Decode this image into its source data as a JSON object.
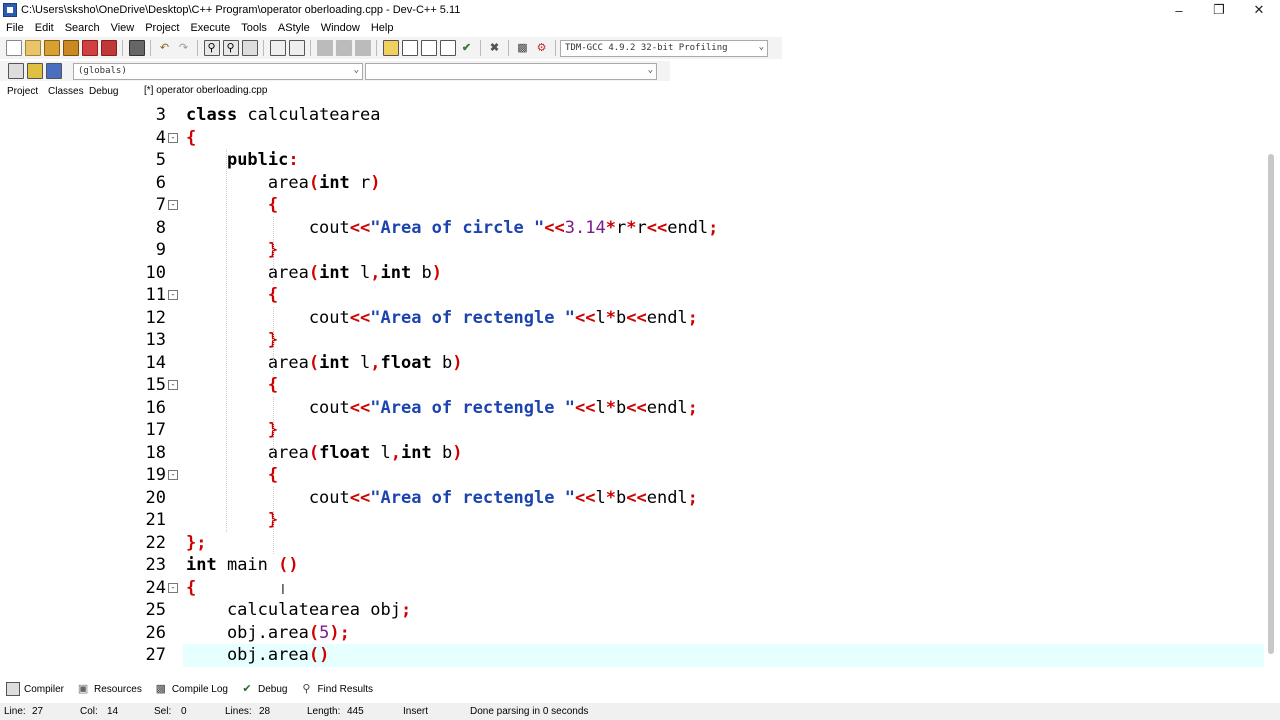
{
  "window": {
    "title": "C:\\Users\\sksho\\OneDrive\\Desktop\\C++ Program\\operator oberloading.cpp - Dev-C++ 5.11"
  },
  "menu": [
    "File",
    "Edit",
    "Search",
    "View",
    "Project",
    "Execute",
    "Tools",
    "AStyle",
    "Window",
    "Help"
  ],
  "toolbar": {
    "compiler_select": "TDM-GCC 4.9.2 32-bit Profiling",
    "scope_select": "(globals)",
    "symbol_select": ""
  },
  "left_tabs": [
    "Project",
    "Classes",
    "Debug"
  ],
  "file_tab": "[*] operator oberloading.cpp",
  "editor": {
    "lines": [
      {
        "n": "3",
        "fold": false,
        "text": "class calculatearea"
      },
      {
        "n": "4",
        "fold": true,
        "text": "{"
      },
      {
        "n": "5",
        "fold": false,
        "text": "    public:"
      },
      {
        "n": "6",
        "fold": false,
        "text": "        area(int r)"
      },
      {
        "n": "7",
        "fold": true,
        "text": "        {"
      },
      {
        "n": "8",
        "fold": false,
        "text": "            cout<<\"Area of circle \"<<3.14*r*r<<endl;"
      },
      {
        "n": "9",
        "fold": false,
        "text": "        }"
      },
      {
        "n": "10",
        "fold": false,
        "text": "        area(int l,int b)"
      },
      {
        "n": "11",
        "fold": true,
        "text": "        {"
      },
      {
        "n": "12",
        "fold": false,
        "text": "            cout<<\"Area of rectengle \"<<l*b<<endl;"
      },
      {
        "n": "13",
        "fold": false,
        "text": "        }"
      },
      {
        "n": "14",
        "fold": false,
        "text": "        area(int l,float b)"
      },
      {
        "n": "15",
        "fold": true,
        "text": "        {"
      },
      {
        "n": "16",
        "fold": false,
        "text": "            cout<<\"Area of rectengle \"<<l*b<<endl;"
      },
      {
        "n": "17",
        "fold": false,
        "text": "        }"
      },
      {
        "n": "18",
        "fold": false,
        "text": "        area(float l,int b)"
      },
      {
        "n": "19",
        "fold": true,
        "text": "        {"
      },
      {
        "n": "20",
        "fold": false,
        "text": "            cout<<\"Area of rectengle \"<<l*b<<endl;"
      },
      {
        "n": "21",
        "fold": false,
        "text": "        }"
      },
      {
        "n": "22",
        "fold": false,
        "text": "};"
      },
      {
        "n": "23",
        "fold": false,
        "text": "int main ()"
      },
      {
        "n": "24",
        "fold": true,
        "text": "{"
      },
      {
        "n": "25",
        "fold": false,
        "text": "    calculatearea obj;"
      },
      {
        "n": "26",
        "fold": false,
        "text": "    obj.area(5);"
      },
      {
        "n": "27",
        "fold": false,
        "text": "    obj.area()",
        "current": true
      }
    ]
  },
  "bottom_tabs": [
    "Compiler",
    "Resources",
    "Compile Log",
    "Debug",
    "Find Results"
  ],
  "status": {
    "line_label": "Line:",
    "line": "27",
    "col_label": "Col:",
    "col": "14",
    "sel_label": "Sel:",
    "sel": "0",
    "lines_label": "Lines:",
    "lines": "28",
    "length_label": "Length:",
    "length": "445",
    "mode": "Insert",
    "message": "Done parsing in 0 seconds"
  }
}
